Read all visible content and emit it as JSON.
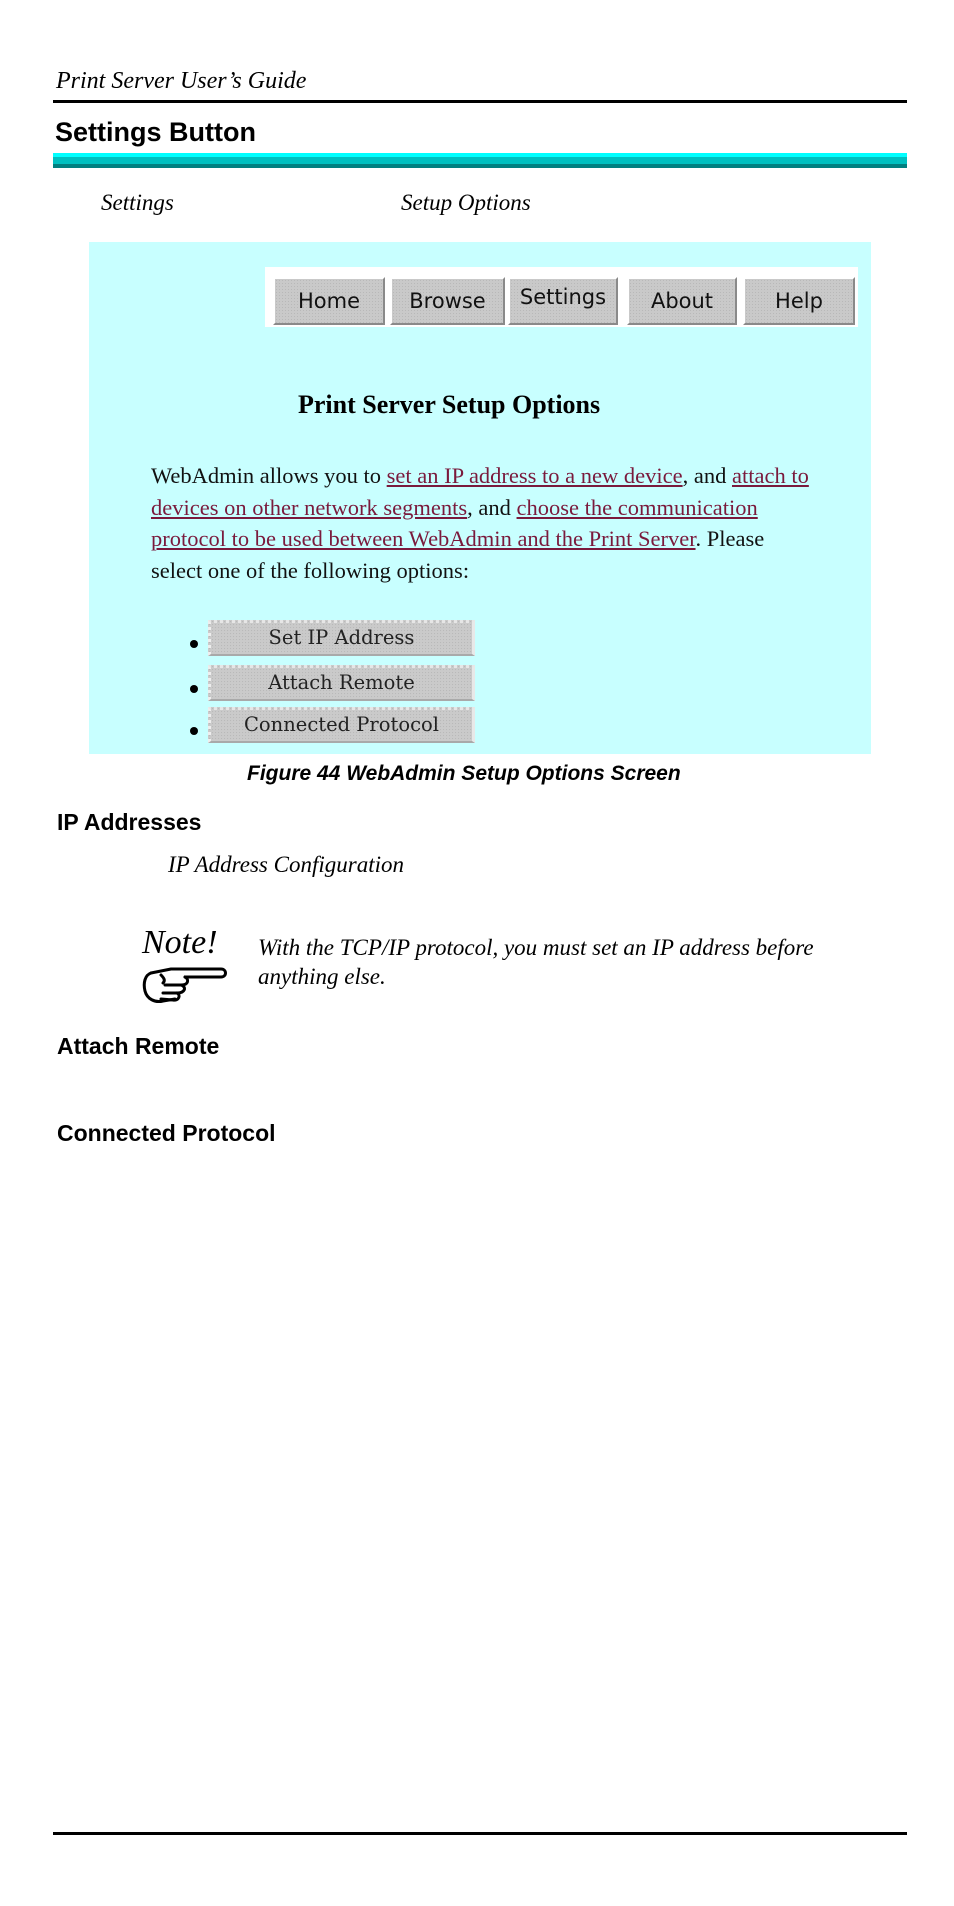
{
  "page": {
    "running_header": "Print Server User’s Guide",
    "section_title": "Settings Button",
    "intro": {
      "settings_word": "Settings",
      "setup_options_word": "Setup Options"
    }
  },
  "screen": {
    "background_color": "#c8ffff",
    "nav": [
      {
        "label": "Home",
        "selected": false
      },
      {
        "label": "Browse",
        "selected": false
      },
      {
        "label": "Settings",
        "selected": true
      },
      {
        "label": "About",
        "selected": false
      },
      {
        "label": "Help",
        "selected": false
      }
    ],
    "title": "Print Server Setup Options",
    "paragraph": {
      "t1": "WebAdmin allows you to ",
      "link1": "set an IP address to a new device",
      "t2": ", and ",
      "link2": "attach to devices on other network segments",
      "t3": ", and ",
      "link3": "choose the communication protocol to be used between WebAdmin and the Print Server",
      "t4": ". Please select one of the following options:"
    },
    "link_color": "#7a1a3c",
    "options": [
      "Set IP Address",
      "Attach Remote",
      "Connected Protocol"
    ]
  },
  "figure_caption": "Figure 44 WebAdmin Setup Options Screen",
  "sections": {
    "ip_addresses": "IP Addresses",
    "ip_address_configuration": "IP Address Configuration",
    "note_label": "Note!",
    "note_text": "With the TCP/IP protocol, you must set an IP address before anything else.",
    "attach_remote": "Attach Remote",
    "connected_protocol": "Connected Protocol"
  },
  "colors": {
    "teal_bar": [
      "#00ffff",
      "#00c0c0",
      "#008080"
    ]
  }
}
